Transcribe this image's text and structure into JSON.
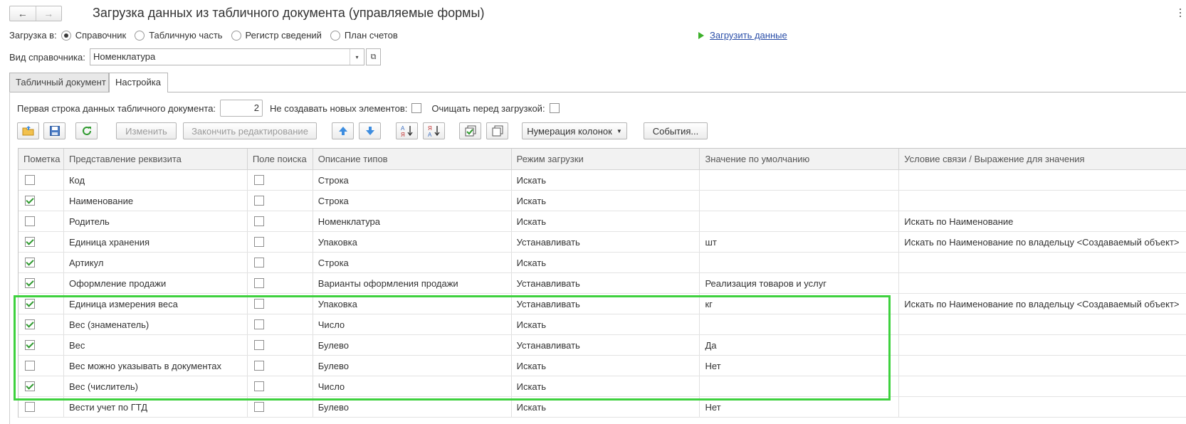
{
  "header": {
    "title": "Загрузка данных из табличного документа (управляемые формы)",
    "back_icon": "←",
    "forward_icon": "→"
  },
  "load_to": {
    "label": "Загрузка в:",
    "options": [
      {
        "label": "Справочник",
        "selected": true
      },
      {
        "label": "Табличную часть",
        "selected": false
      },
      {
        "label": "Регистр сведений",
        "selected": false
      },
      {
        "label": "План счетов",
        "selected": false
      }
    ]
  },
  "load_link": {
    "label": "Загрузить данные",
    "color": "#2a4ea8",
    "icon_color": "#3cb02a"
  },
  "catalog": {
    "label": "Вид справочника:",
    "value": "Номенклатура",
    "dropdown_icon": "▾",
    "open_icon": "⧉"
  },
  "tabs": [
    {
      "label": "Табличный документ",
      "active": false
    },
    {
      "label": "Настройка",
      "active": true
    }
  ],
  "settings": {
    "first_row_label": "Первая строка данных табличного документа:",
    "first_row_value": "2",
    "no_new_label": "Не создавать новых элементов:",
    "no_new_checked": false,
    "clear_label": "Очищать перед загрузкой:",
    "clear_checked": false
  },
  "toolbar": {
    "edit_label": "Изменить",
    "finish_label": "Закончить редактирование",
    "numbering_label": "Нумерация колонок",
    "events_label": "События..."
  },
  "table": {
    "columns": [
      "Пометка",
      "Представление реквизита",
      "Поле поиска",
      "Описание типов",
      "Режим загрузки",
      "Значение по умолчанию",
      "Условие связи / Выражение для значения"
    ],
    "rows": [
      {
        "mark": false,
        "name": "Код",
        "search": false,
        "type": "Строка",
        "mode": "Искать",
        "default": "",
        "condition": ""
      },
      {
        "mark": true,
        "name": "Наименование",
        "search": false,
        "type": "Строка",
        "mode": "Искать",
        "default": "",
        "condition": ""
      },
      {
        "mark": false,
        "name": "Родитель",
        "search": false,
        "type": "Номенклатура",
        "mode": "Искать",
        "default": "",
        "condition": "Искать по Наименование"
      },
      {
        "mark": true,
        "name": "Единица хранения",
        "search": false,
        "type": "Упаковка",
        "mode": "Устанавливать",
        "default": "шт",
        "condition": "Искать по Наименование по владельцу <Создаваемый объект>"
      },
      {
        "mark": true,
        "name": "Артикул",
        "search": false,
        "type": "Строка",
        "mode": "Искать",
        "default": "",
        "condition": ""
      },
      {
        "mark": true,
        "name": "Оформление продажи",
        "search": false,
        "type": "Варианты оформления продажи",
        "mode": "Устанавливать",
        "default": "Реализация товаров и услуг",
        "condition": ""
      },
      {
        "mark": true,
        "name": "Единица измерения веса",
        "search": false,
        "type": "Упаковка",
        "mode": "Устанавливать",
        "default": "кг",
        "condition": "Искать по Наименование по владельцу <Создаваемый объект>"
      },
      {
        "mark": true,
        "name": "Вес (знаменатель)",
        "search": false,
        "type": "Число",
        "mode": "Искать",
        "default": "",
        "condition": ""
      },
      {
        "mark": true,
        "name": "Вес",
        "search": false,
        "type": "Булево",
        "mode": "Устанавливать",
        "default": "Да",
        "condition": ""
      },
      {
        "mark": false,
        "name": "Вес можно указывать в документах",
        "search": false,
        "type": "Булево",
        "mode": "Искать",
        "default": "Нет",
        "condition": ""
      },
      {
        "mark": true,
        "name": "Вес (числитель)",
        "search": false,
        "type": "Число",
        "mode": "Искать",
        "default": "",
        "condition": ""
      },
      {
        "mark": false,
        "name": "Вести учет по ГТД",
        "search": false,
        "type": "Булево",
        "mode": "Искать",
        "default": "Нет",
        "condition": ""
      }
    ]
  },
  "highlight_color": "#3ed13e"
}
